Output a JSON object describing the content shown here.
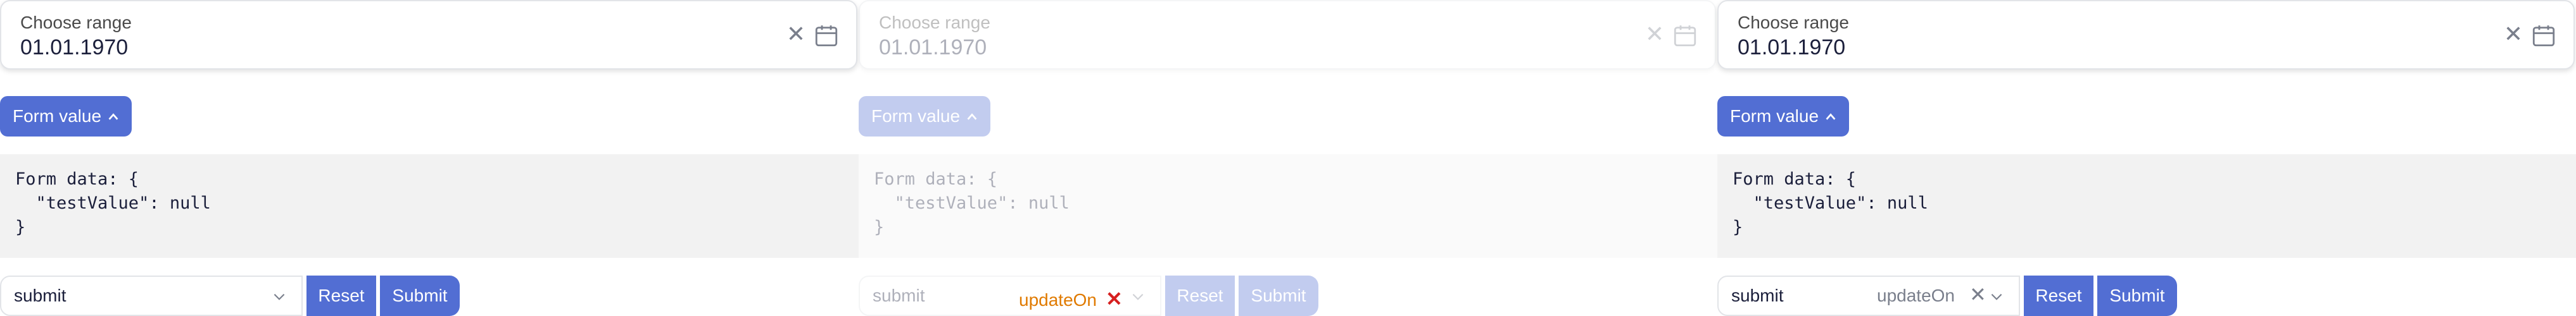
{
  "colors": {
    "accent": "#526ed3",
    "code_bg": "#f2f2f2",
    "updateon_warning": "#e07a00",
    "warning_x": "#d61f1f"
  },
  "columns": [
    {
      "state": "enabled",
      "range": {
        "label": "Choose range",
        "value": "01.01.1970",
        "clear_icon": "✕",
        "calendar_icon": "calendar-icon"
      },
      "form_button": {
        "label": "Form value",
        "icon": "chevron-up-icon"
      },
      "code_lines": [
        "Form data: {",
        "  \"testValue\": null",
        "}"
      ],
      "select": {
        "value": "submit",
        "icon": "chevron-down-icon"
      },
      "reset_label": "Reset",
      "submit_label": "Submit"
    },
    {
      "state": "disabled",
      "range": {
        "label": "Choose range",
        "value": "01.01.1970",
        "clear_icon": "✕",
        "calendar_icon": "calendar-icon"
      },
      "form_button": {
        "label": "Form value",
        "icon": "chevron-up-icon"
      },
      "code_lines": [
        "Form data: {",
        "  \"testValue\": null",
        "}"
      ],
      "select": {
        "value": "submit",
        "icon": "chevron-down-icon"
      },
      "updateon": {
        "label": "updateOn",
        "clear_icon": "✕"
      },
      "reset_label": "Reset",
      "submit_label": "Submit"
    },
    {
      "state": "enabled",
      "range": {
        "label": "Choose range",
        "value": "01.01.1970",
        "clear_icon": "✕",
        "calendar_icon": "calendar-icon"
      },
      "form_button": {
        "label": "Form value",
        "icon": "chevron-up-icon"
      },
      "code_lines": [
        "Form data: {",
        "  \"testValue\": null",
        "}"
      ],
      "select": {
        "value": "submit",
        "icon": "chevron-down-icon"
      },
      "updateon": {
        "label": "updateOn",
        "clear_icon": "✕"
      },
      "reset_label": "Reset",
      "submit_label": "Submit"
    }
  ]
}
